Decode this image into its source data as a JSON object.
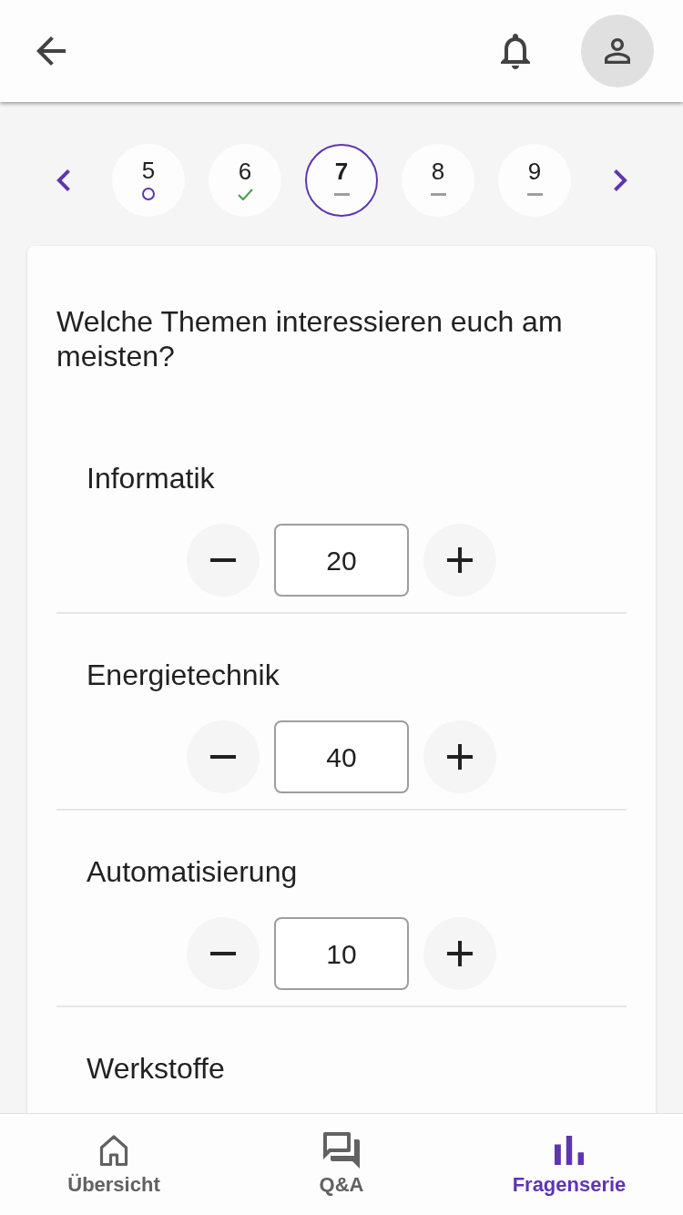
{
  "pager": {
    "pages": [
      {
        "label": "5",
        "kind": "open",
        "selected": false
      },
      {
        "label": "6",
        "kind": "answered",
        "selected": false
      },
      {
        "label": "7",
        "kind": "unanswered",
        "selected": true
      },
      {
        "label": "8",
        "kind": "unanswered",
        "selected": false
      },
      {
        "label": "9",
        "kind": "unanswered",
        "selected": false
      }
    ]
  },
  "question": {
    "text": "Welche Themen interessieren euch am meisten?",
    "items": [
      {
        "label": "Informatik",
        "value": "20"
      },
      {
        "label": "Energietechnik",
        "value": "40"
      },
      {
        "label": "Automatisierung",
        "value": "10"
      },
      {
        "label": "Werkstoffe"
      }
    ]
  },
  "bottom_nav": [
    {
      "label": "Übersicht",
      "selected": false
    },
    {
      "label": "Q&A",
      "selected": false
    },
    {
      "label": "Fragenserie",
      "selected": true
    }
  ]
}
